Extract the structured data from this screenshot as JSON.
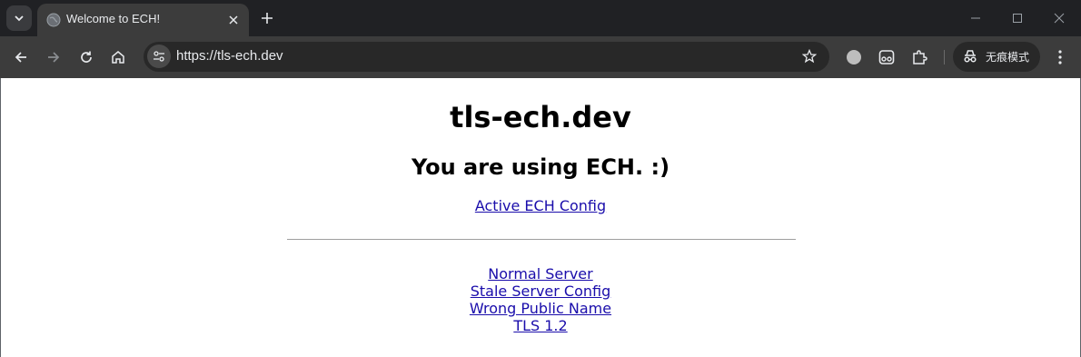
{
  "browser": {
    "tab_title": "Welcome to ECH!",
    "url": "https://tls-ech.dev",
    "profile_label": "无痕模式",
    "icons": [
      "tab-search-icon",
      "globe-icon",
      "close-icon",
      "plus-icon",
      "minimize-icon",
      "maximize-icon",
      "close-window-icon",
      "back-icon",
      "forward-icon",
      "reload-icon",
      "home-icon",
      "site-info-icon",
      "star-icon",
      "extension-circle-icon",
      "extension-mask-icon",
      "puzzle-icon",
      "incognito-icon",
      "more-icon"
    ],
    "colors": {
      "frame": "#202124",
      "toolbar": "#3c3c3c",
      "omnibox": "#282828",
      "link": "#1a0dab"
    }
  },
  "page": {
    "title": "tls-ech.dev",
    "status": "You are using ECH. :)",
    "active_config_link": "Active ECH Config",
    "links": [
      {
        "label": "Normal Server"
      },
      {
        "label": "Stale Server Config"
      },
      {
        "label": "Wrong Public Name"
      },
      {
        "label": "TLS 1.2"
      }
    ]
  }
}
